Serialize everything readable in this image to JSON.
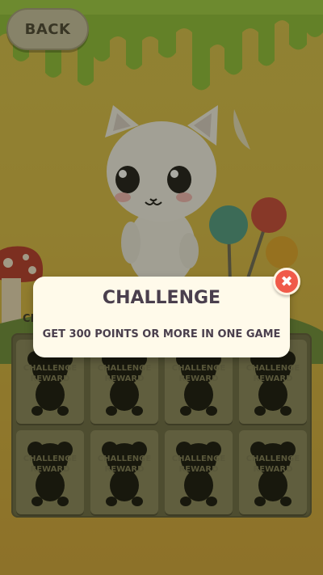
{
  "colors": {
    "slime_green": "#8fbe3a",
    "background_yellow": "#d7c04d",
    "dialog_bg": "#fffaea",
    "dialog_text": "#4a3f4d",
    "close_red": "#f05a4a"
  },
  "header": {
    "back_label": "BACK"
  },
  "collection": {
    "label_partial": "CH",
    "cells": [
      {
        "line1": "CHALLENGE",
        "line2": "REWARD",
        "icon": "locked-bear-silhouette-icon"
      },
      {
        "line1": "CHALLENGE",
        "line2": "REWARD",
        "icon": "locked-bear-silhouette-icon"
      },
      {
        "line1": "CHALLENGE",
        "line2": "REWARD",
        "icon": "locked-bear-silhouette-icon"
      },
      {
        "line1": "CHALLENGE",
        "line2": "REWARD",
        "icon": "locked-bear-silhouette-icon"
      },
      {
        "line1": "CHALLENGE",
        "line2": "REWARD",
        "icon": "locked-bear-silhouette-icon"
      },
      {
        "line1": "CHALLENGE",
        "line2": "REWARD",
        "icon": "locked-bear-silhouette-icon"
      },
      {
        "line1": "CHALLENGE",
        "line2": "REWARD",
        "icon": "locked-bear-silhouette-icon"
      },
      {
        "line1": "CHALLENGE",
        "line2": "REWARD",
        "icon": "locked-bear-silhouette-icon"
      }
    ]
  },
  "dialog": {
    "title": "CHALLENGE",
    "description": "GET 300 POINTS OR MORE IN ONE GAME",
    "close_icon": "close-x-icon"
  }
}
